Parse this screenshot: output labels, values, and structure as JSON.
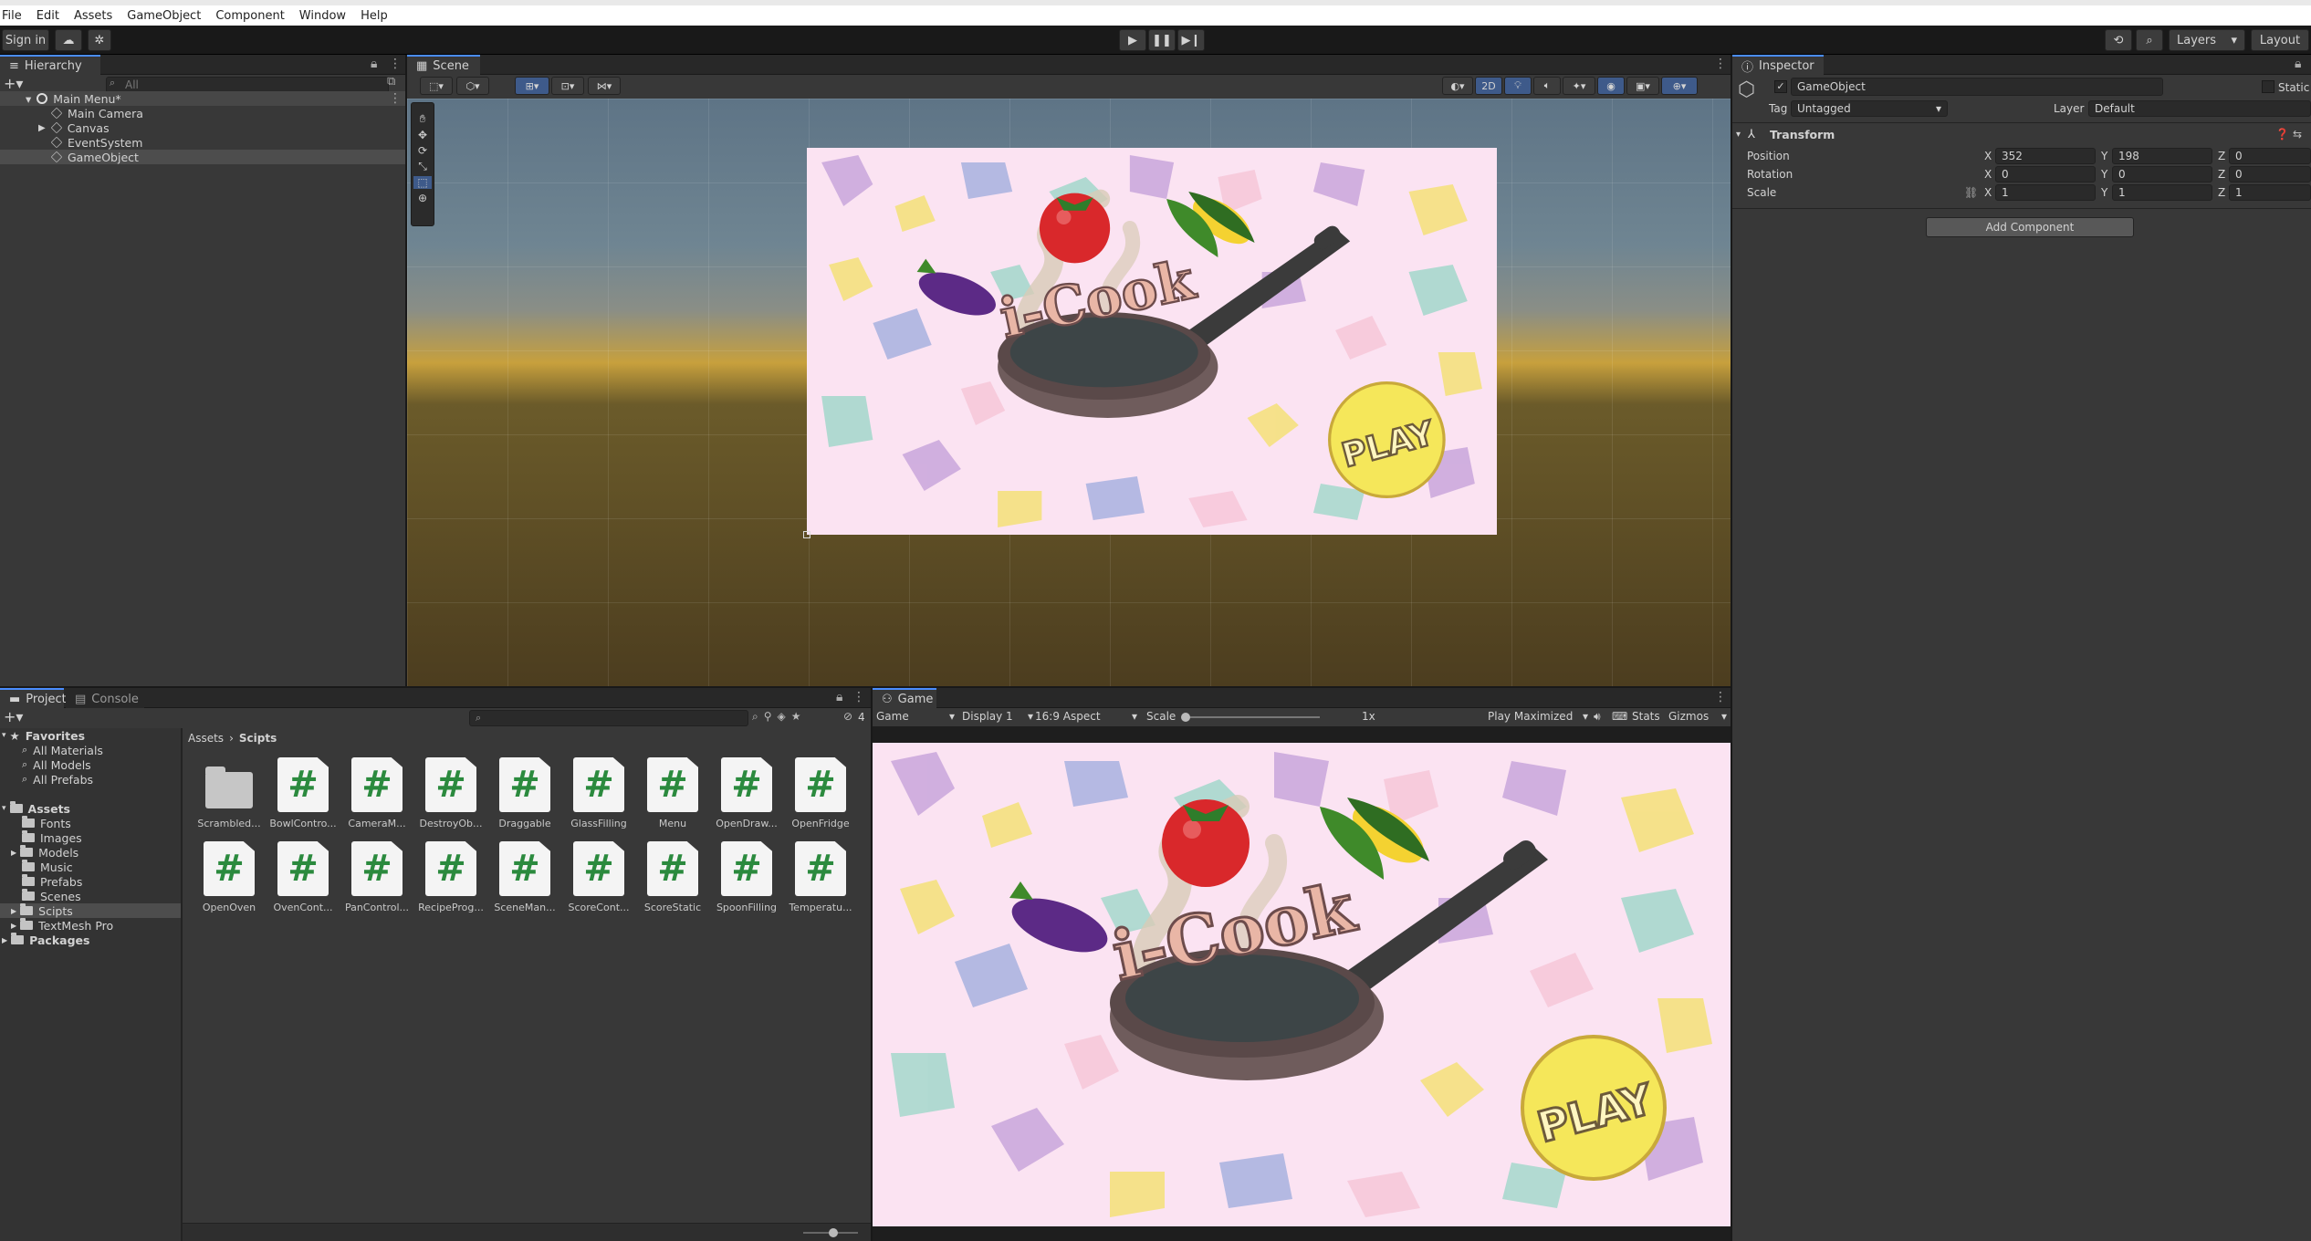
{
  "menu": [
    "File",
    "Edit",
    "Assets",
    "GameObject",
    "Component",
    "Window",
    "Help"
  ],
  "toolbar": {
    "sign_in": "Sign in",
    "layers": "Layers",
    "layout": "Layout"
  },
  "hierarchy": {
    "tab": "Hierarchy",
    "search_placeholder": "All",
    "scene": "Main Menu*",
    "items": [
      "Main Camera",
      "Canvas",
      "EventSystem",
      "GameObject"
    ]
  },
  "scene_view": {
    "tab": "Scene",
    "mode_2d": "2D"
  },
  "inspector": {
    "tab": "Inspector",
    "object_name": "GameObject",
    "static_label": "Static",
    "tag_label": "Tag",
    "tag_value": "Untagged",
    "layer_label": "Layer",
    "layer_value": "Default",
    "component": "Transform",
    "position_label": "Position",
    "rotation_label": "Rotation",
    "scale_label": "Scale",
    "position": {
      "x": "352",
      "y": "198",
      "z": "0"
    },
    "rotation": {
      "x": "0",
      "y": "0",
      "z": "0"
    },
    "scale": {
      "x": "1",
      "y": "1",
      "z": "1"
    },
    "axis": {
      "x": "X",
      "y": "Y",
      "z": "Z"
    },
    "add_component": "Add Component"
  },
  "project": {
    "tab_project": "Project",
    "tab_console": "Console",
    "hidden_count": "4",
    "favorites": "Favorites",
    "favorite_items": [
      "All Materials",
      "All Models",
      "All Prefabs"
    ],
    "assets": "Assets",
    "asset_folders": [
      "Fonts",
      "Images",
      "Models",
      "Music",
      "Prefabs",
      "Scenes",
      "Scipts",
      "TextMesh Pro"
    ],
    "packages": "Packages",
    "breadcrumb_root": "Assets",
    "breadcrumb_current": "Scipts",
    "files": [
      "Scrambled...",
      "BowlContro...",
      "CameraM...",
      "DestroyOb...",
      "Draggable",
      "GlassFilling",
      "Menu",
      "OpenDraw...",
      "OpenFridge",
      "OpenOven",
      "OvenCont...",
      "PanControl...",
      "RecipeProg...",
      "SceneMan...",
      "ScoreCont...",
      "ScoreStatic",
      "SpoonFilling",
      "Temperatu..."
    ]
  },
  "game_view": {
    "tab": "Game",
    "mode": "Game",
    "display": "Display 1",
    "aspect": "16:9 Aspect",
    "scale_label": "Scale",
    "scale_value": "1x",
    "play_mode": "Play Maximized",
    "stats": "Stats",
    "gizmos": "Gizmos"
  },
  "artwork": {
    "logo": "i-Cook",
    "play_button": "PLAY"
  },
  "colors": {
    "accent": "#4a8dff",
    "panel": "#383838",
    "toolbar": "#191919",
    "art_bg": "#fbe3f2",
    "play": "#f5e75a"
  }
}
